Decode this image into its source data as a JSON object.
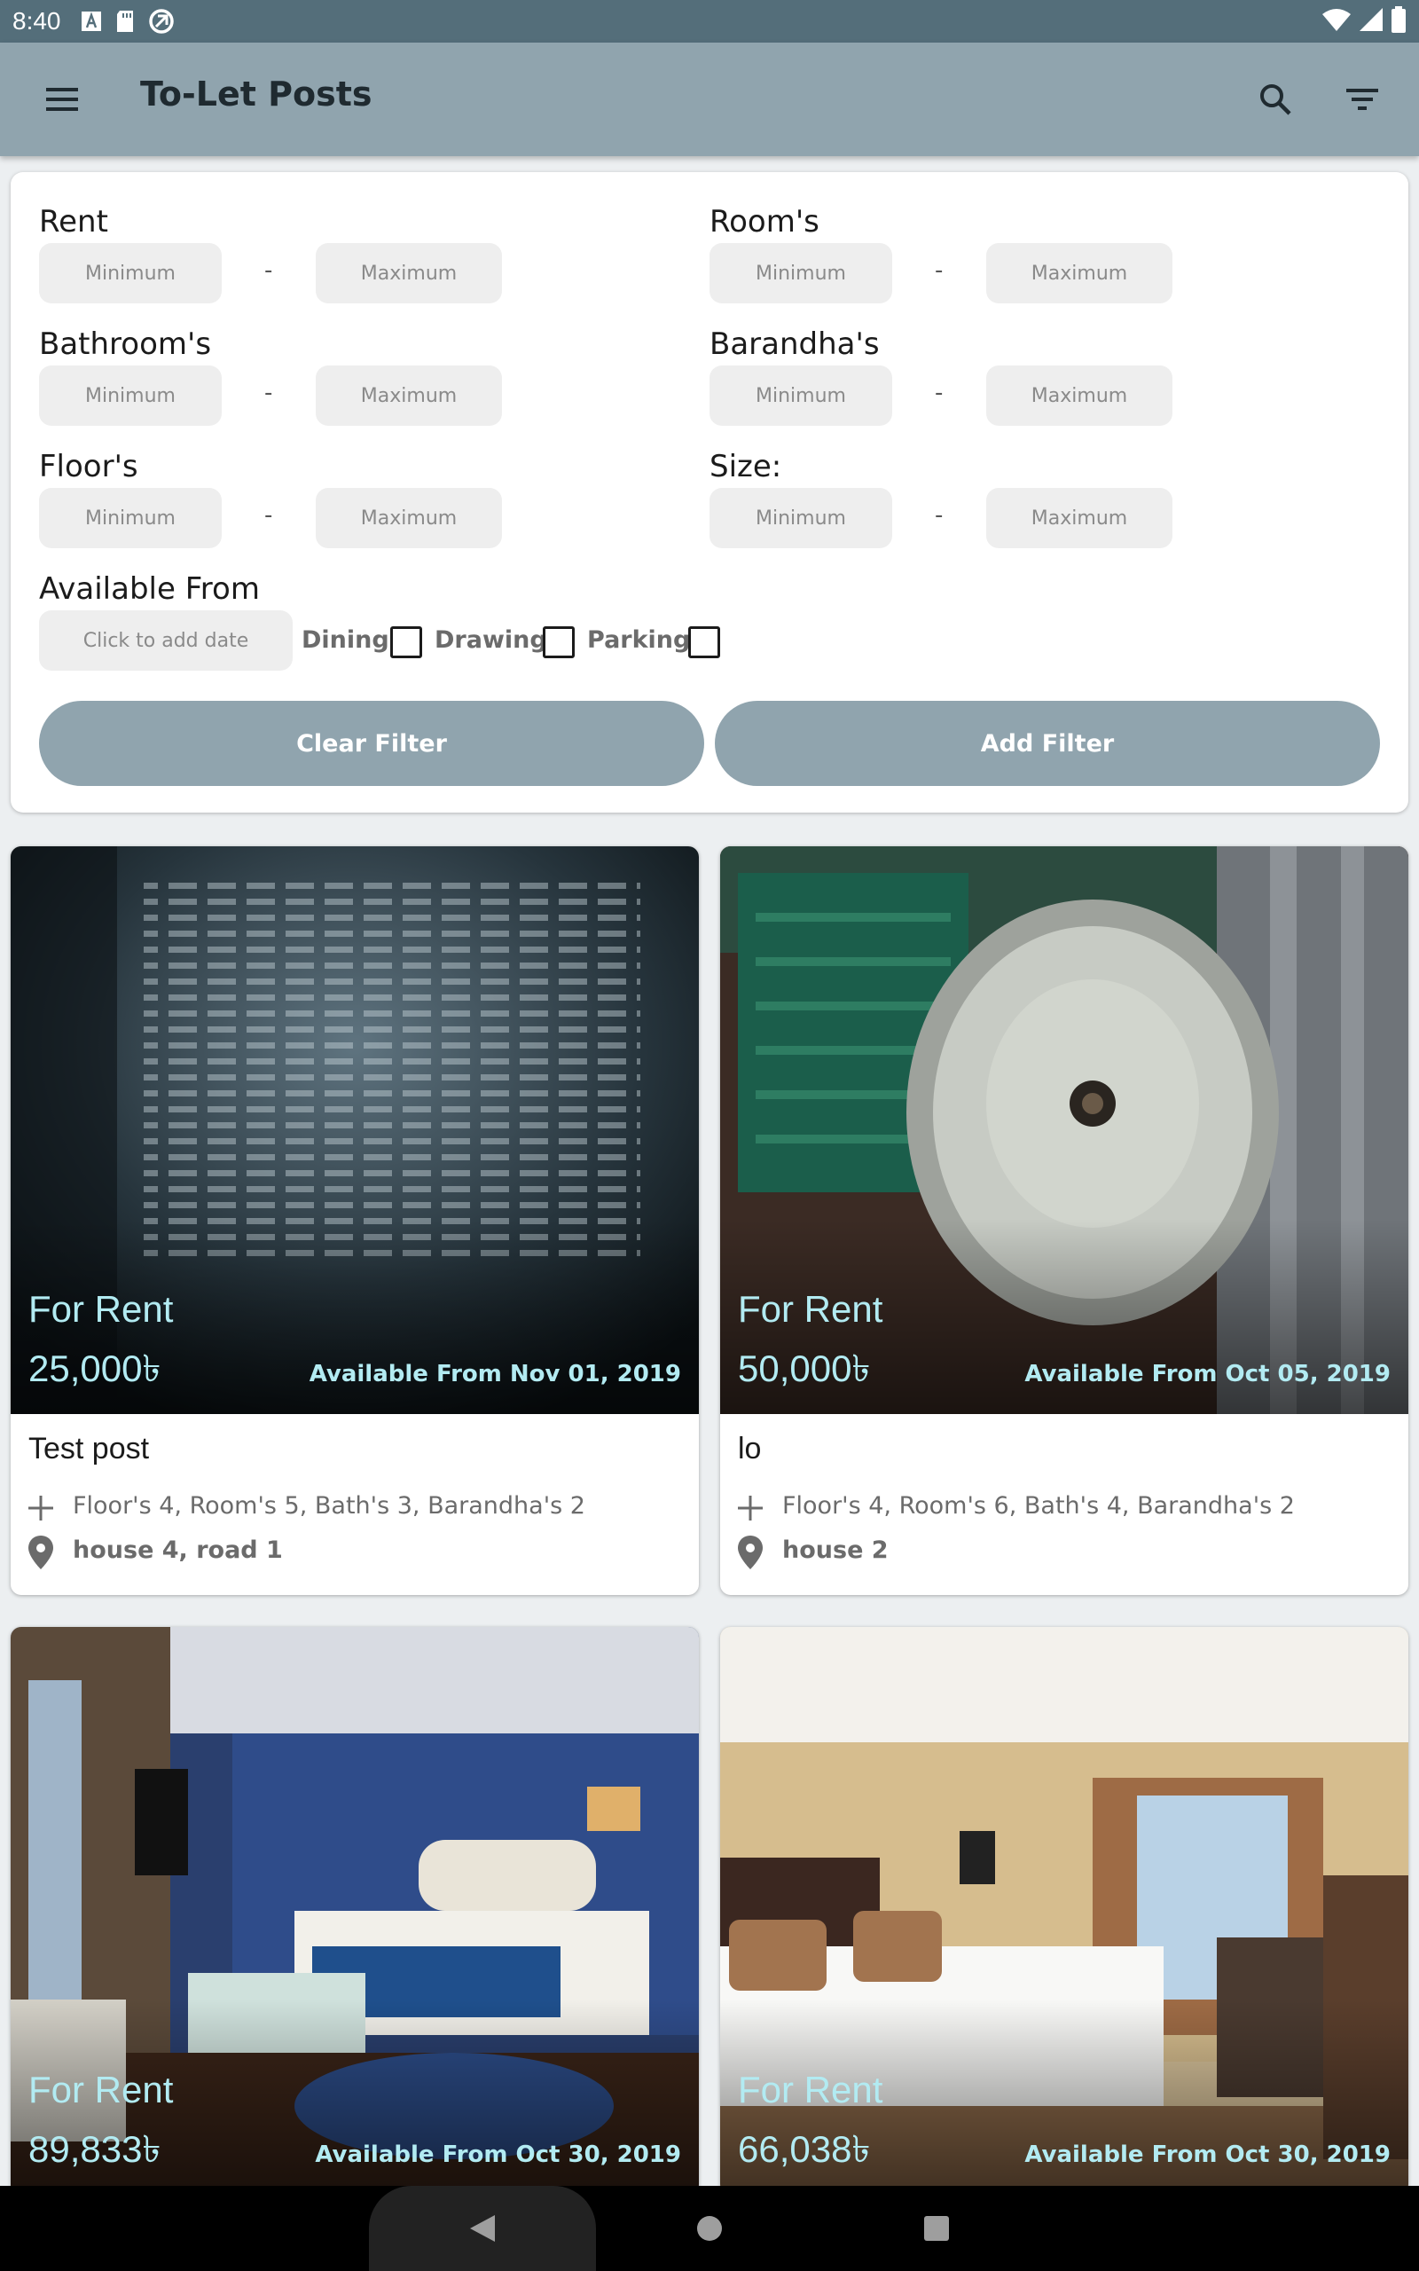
{
  "status_bar": {
    "time": "8:40",
    "icons": [
      "text-a-icon",
      "sd-card-icon",
      "vpn-icon",
      "wifi-icon",
      "signal-icon",
      "battery-icon"
    ]
  },
  "app_bar": {
    "title": "To-Let Posts",
    "icons": [
      "menu-icon",
      "search-icon",
      "filter-list-icon"
    ]
  },
  "filter": {
    "rent_label": "Rent",
    "rooms_label": "Room's",
    "bathrooms_label": "Bathroom's",
    "barandhas_label": "Barandha's",
    "floors_label": "Floor's",
    "size_label": "Size:",
    "min_placeholder": "Minimum",
    "max_placeholder": "Maximum",
    "separator": "-",
    "available_from_label": "Available From",
    "date_placeholder": "Click to add date",
    "dining_label": "Dining",
    "drawing_label": "Drawing",
    "parking_label": "Parking",
    "clear_button": "Clear Filter",
    "add_button": "Add Filter"
  },
  "posts": [
    {
      "status": "For Rent",
      "price": "25,000৳",
      "available": "Available From Nov 01, 2019",
      "title": "Test post",
      "details": "Floor's 4, Room's 5, Bath's 3, Barandha's 2",
      "address": "house 4, road 1"
    },
    {
      "status": "For Rent",
      "price": "50,000৳",
      "available": "Available From Oct 05, 2019",
      "title": "lo",
      "details": "Floor's 4, Room's 6, Bath's 4, Barandha's 2",
      "address": "house 2"
    },
    {
      "status": "For Rent",
      "price": "89,833৳",
      "available": "Available From Oct 30, 2019"
    },
    {
      "status": "For Rent",
      "price": "66,038৳",
      "available": "Available From Oct 30, 2019"
    }
  ],
  "colors": {
    "status_bar": "#546e7a",
    "app_bar": "#90a4ae",
    "button": "#90a4ae",
    "overlay_text": "#b2ebf2"
  },
  "nav_bar": {
    "icons": [
      "back-icon",
      "home-icon",
      "recents-icon"
    ]
  }
}
